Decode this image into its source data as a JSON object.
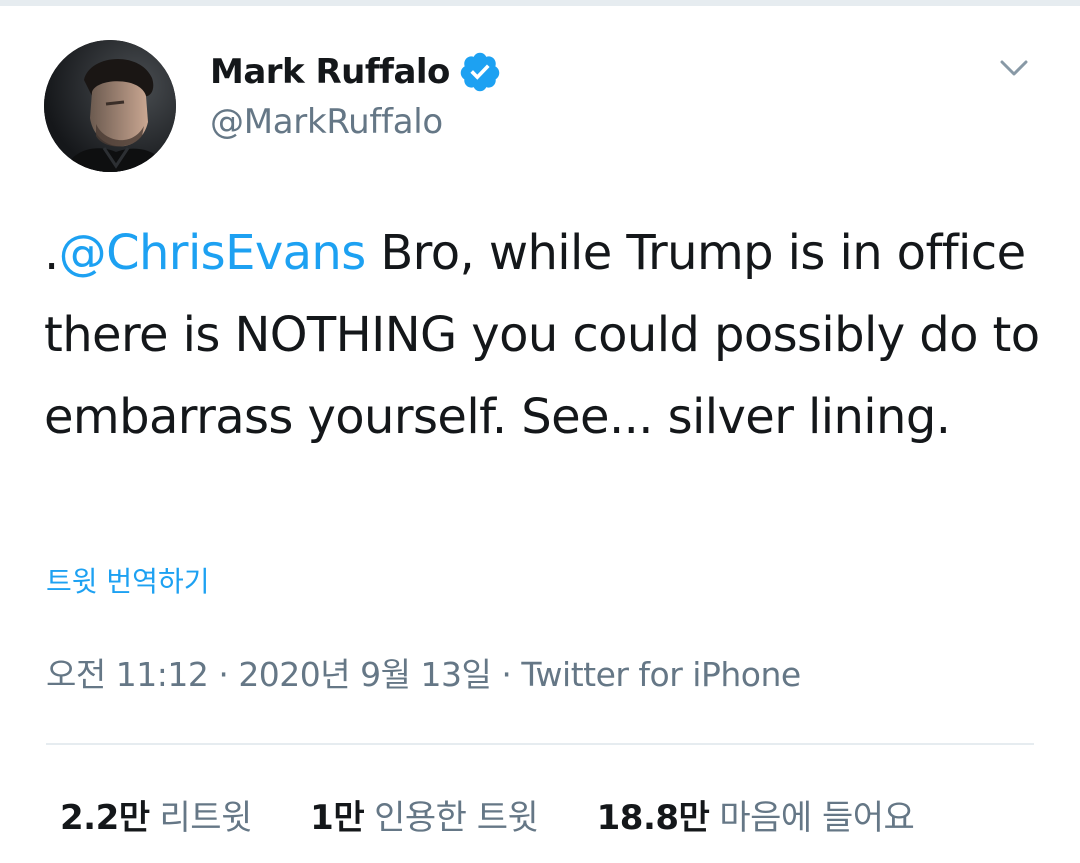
{
  "user": {
    "display_name": "Mark Ruffalo",
    "handle": "@MarkRuffalo",
    "verified": true,
    "verified_color": "#1da1f2"
  },
  "icons": {
    "verified": "verified-badge-icon",
    "more": "chevron-down-icon"
  },
  "tweet": {
    "prefix": ".",
    "mention": "@ChrisEvans",
    "body": " Bro, while Trump is in office there is NOTHING you could possibly do to embarrass yourself. See... silver lining."
  },
  "translate_label": "트윗 번역하기",
  "meta": {
    "time": "오전 11:12",
    "separator": "·",
    "date": "2020년 9월 13일",
    "source": "Twitter for iPhone"
  },
  "stats": {
    "retweets": {
      "count": "2.2만",
      "label": "리트윗"
    },
    "quotes": {
      "count": "1만",
      "label": "인용한 트윗"
    },
    "likes": {
      "count": "18.8만",
      "label": "마음에 들어요"
    }
  },
  "colors": {
    "accent": "#1da1f2",
    "text": "#14171a",
    "muted": "#657786",
    "divider": "#e6ecf0"
  }
}
